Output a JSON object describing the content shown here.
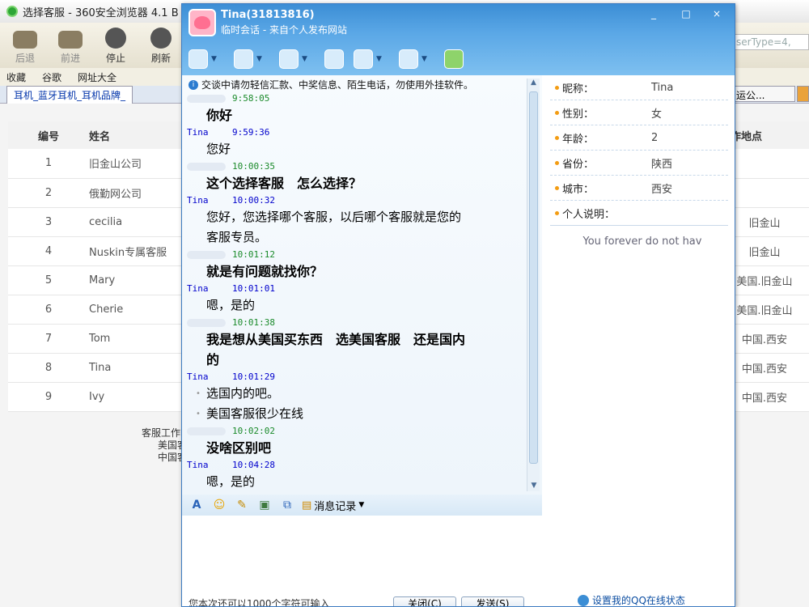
{
  "browser": {
    "title": "选择客服 - 360安全浏览器 4.1 B",
    "nav": [
      "后退",
      "前进",
      "停止",
      "刷新",
      "主页"
    ],
    "favorites": [
      "收藏",
      "谷歌",
      "网址大全"
    ],
    "tab": "耳机_蓝牙耳机_耳机品牌_",
    "address_peek": "serType=4,",
    "tab_peek": "运公..."
  },
  "page": {
    "columns": [
      "编号",
      "姓名",
      "工作地点"
    ],
    "rows": [
      {
        "no": "1",
        "name": "旧金山公司",
        "loc": ""
      },
      {
        "no": "2",
        "name": "俄勤网公司",
        "loc": ""
      },
      {
        "no": "3",
        "name": "cecilia",
        "loc": "旧金山"
      },
      {
        "no": "4",
        "name": "Nuskin专属客服",
        "loc": "旧金山"
      },
      {
        "no": "5",
        "name": "Mary",
        "loc": "美国.旧金山"
      },
      {
        "no": "6",
        "name": "Cherie",
        "loc": "美国.旧金山"
      },
      {
        "no": "7",
        "name": "Tom",
        "loc": "中国.西安"
      },
      {
        "no": "8",
        "name": "Tina",
        "loc": "中国.西安"
      },
      {
        "no": "9",
        "name": "Ivy",
        "loc": "中国.西安"
      }
    ],
    "footer_lines": [
      "客服工作时",
      "美国客",
      "中国客"
    ]
  },
  "qq": {
    "title": "Tina(31813816)",
    "subtitle": "临时会话 - 来自个人发布网站",
    "window_buttons": [
      "_",
      "□",
      "×"
    ],
    "notice": "交谈中请勿轻信汇款、中奖信息、陌生电话，勿使用外挂软件。",
    "messages": [
      {
        "sender": "",
        "time": "9:58:05",
        "mine": true,
        "lines": [
          "你好"
        ]
      },
      {
        "sender": "Tina",
        "time": "9:59:36",
        "mine": false,
        "lines": [
          "您好"
        ]
      },
      {
        "sender": "",
        "time": "10:00:35",
        "mine": true,
        "lines": [
          "这个选择客服　怎么选择？"
        ]
      },
      {
        "sender": "Tina",
        "time": "10:00:32",
        "mine": false,
        "lines": [
          "您好，您选择哪个客服，以后哪个客服就是您的",
          "客服专员。"
        ]
      },
      {
        "sender": "",
        "time": "10:01:12",
        "mine": true,
        "lines": [
          "就是有问题就找你？"
        ]
      },
      {
        "sender": "Tina",
        "time": "10:01:01",
        "mine": false,
        "lines": [
          "嗯，是的"
        ]
      },
      {
        "sender": "",
        "time": "10:01:38",
        "mine": true,
        "lines": [
          "我是想从美国买东西　选美国客服　还是国内",
          "的"
        ]
      },
      {
        "sender": "Tina",
        "time": "10:01:29",
        "mine": false,
        "lines": [
          "选国内的吧。",
          "美国客服很少在线"
        ]
      },
      {
        "sender": "",
        "time": "10:02:02",
        "mine": true,
        "lines": [
          "没啥区别吧"
        ]
      },
      {
        "sender": "Tina",
        "time": "10:04:28",
        "mine": false,
        "lines": [
          "嗯，是的"
        ]
      }
    ],
    "history_label": "消息记录",
    "hint": "您本次还可以1000个字符可输入",
    "close_label": "关闭(C)",
    "send_label": "发送(S)",
    "profile": [
      {
        "label": "昵称：",
        "value": "Tina"
      },
      {
        "label": "性别：",
        "value": "女"
      },
      {
        "label": "年龄：",
        "value": "2"
      },
      {
        "label": "省份：",
        "value": "陕西"
      },
      {
        "label": "城市：",
        "value": "西安"
      },
      {
        "label": "个人说明：",
        "value": ""
      }
    ],
    "signature": "You forever do not hav",
    "set_status": "设置我的QQ在线状态"
  }
}
